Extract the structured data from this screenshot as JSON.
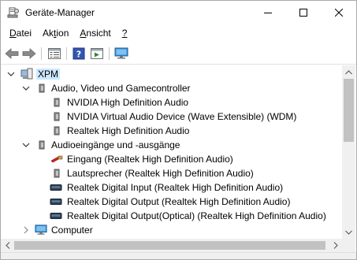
{
  "window": {
    "title": "Geräte-Manager"
  },
  "menu": {
    "items": [
      {
        "pre": "",
        "u": "D",
        "post": "atei"
      },
      {
        "pre": "Ak",
        "u": "t",
        "post": "ion"
      },
      {
        "pre": "",
        "u": "A",
        "post": "nsicht"
      },
      {
        "pre": "",
        "u": "?",
        "post": ""
      }
    ]
  },
  "toolbar": {
    "buttons": [
      "back-icon",
      "forward-icon",
      "properties-icon",
      "help-icon",
      "run-icon",
      "monitor-icon"
    ]
  },
  "tree": {
    "root": {
      "label": "XPM",
      "expanded": true,
      "icon": "computer-icon"
    },
    "categories": [
      {
        "label": "Audio, Video und Gamecontroller",
        "expanded": true,
        "icon": "speaker-icon",
        "children": [
          {
            "label": "NVIDIA High Definition Audio",
            "icon": "speaker-icon"
          },
          {
            "label": "NVIDIA Virtual Audio Device (Wave Extensible) (WDM)",
            "icon": "speaker-icon"
          },
          {
            "label": "Realtek High Definition Audio",
            "icon": "speaker-icon"
          }
        ]
      },
      {
        "label": "Audioeingänge und -ausgänge",
        "expanded": true,
        "icon": "speaker-icon",
        "children": [
          {
            "label": "Eingang (Realtek High Definition Audio)",
            "icon": "line-in-icon"
          },
          {
            "label": "Lautsprecher (Realtek High Definition Audio)",
            "icon": "speaker-icon"
          },
          {
            "label": "Realtek Digital Input (Realtek High Definition Audio)",
            "icon": "digital-port-icon"
          },
          {
            "label": "Realtek Digital Output (Realtek High Definition Audio)",
            "icon": "digital-port-icon"
          },
          {
            "label": "Realtek Digital Output(Optical) (Realtek High Definition Audio)",
            "icon": "digital-port-icon"
          }
        ]
      },
      {
        "label": "Computer",
        "expanded": false,
        "icon": "monitor-icon",
        "children": []
      }
    ]
  },
  "colors": {
    "accent": "#0078d7",
    "scrollbar": "#f0f0f0",
    "thumb": "#c2c2c2"
  }
}
